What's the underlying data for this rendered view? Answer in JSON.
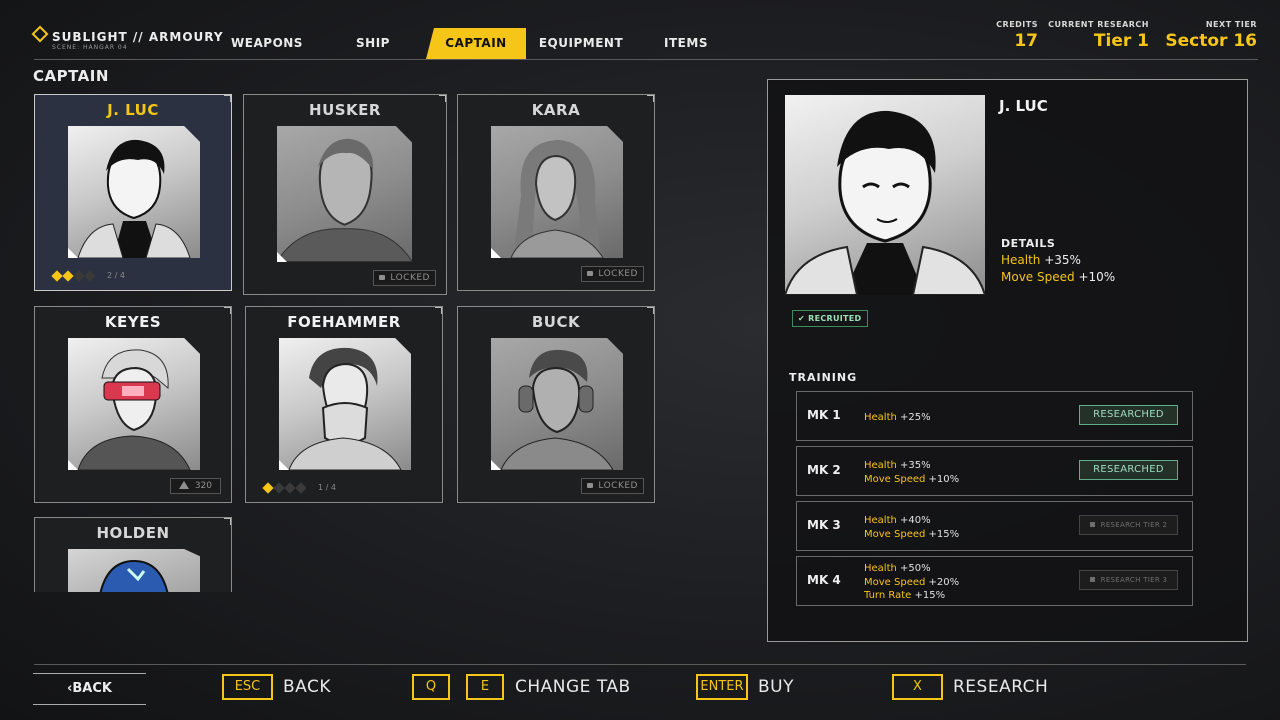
{
  "brand": {
    "title": "SUBLIGHT // ARMOURY",
    "subtitle": "SCENE: HANGAR 04"
  },
  "tabs": [
    {
      "label": "WEAPONS",
      "active": false
    },
    {
      "label": "SHIP",
      "active": false
    },
    {
      "label": "CAPTAIN",
      "active": true
    },
    {
      "label": "EQUIPMENT",
      "active": false
    },
    {
      "label": "ITEMS",
      "active": false
    }
  ],
  "stats": {
    "credits": {
      "label": "CREDITS",
      "value": "17"
    },
    "research": {
      "label": "CURRENT RESEARCH",
      "value": "Tier 1"
    },
    "next": {
      "label": "NEXT TIER",
      "value": "Sector 16"
    }
  },
  "section_title": "CAPTAIN",
  "captains": [
    {
      "name": "J. LUC",
      "status": "owned",
      "progress": "2 / 4",
      "level": 2,
      "max": 4
    },
    {
      "name": "HUSKER",
      "status": "locked",
      "lock_label": "LOCKED"
    },
    {
      "name": "KARA",
      "status": "locked",
      "lock_label": "LOCKED"
    },
    {
      "name": "KEYES",
      "status": "cost",
      "cost": "320"
    },
    {
      "name": "FOEHAMMER",
      "status": "owned",
      "progress": "1 / 4",
      "level": 1,
      "max": 4
    },
    {
      "name": "BUCK",
      "status": "locked",
      "lock_label": "LOCKED"
    },
    {
      "name": "HOLDEN",
      "status": "partial"
    }
  ],
  "detail": {
    "name": "J. LUC",
    "details_label": "DETAILS",
    "lines": [
      {
        "key": "Health",
        "value": "+35%"
      },
      {
        "key": "Move Speed",
        "value": "+10%"
      }
    ],
    "recruited": "RECRUITED",
    "training_label": "TRAINING",
    "training": [
      {
        "mk": "MK 1",
        "stats": [
          {
            "k": "Health",
            "v": "+25%"
          }
        ],
        "button": "RESEARCHED",
        "state": "done"
      },
      {
        "mk": "MK 2",
        "stats": [
          {
            "k": "Health",
            "v": "+35%"
          },
          {
            "k": "Move Speed",
            "v": "+10%"
          }
        ],
        "button": "RESEARCHED",
        "state": "done"
      },
      {
        "mk": "MK 3",
        "stats": [
          {
            "k": "Health",
            "v": "+40%"
          },
          {
            "k": "Move Speed",
            "v": "+15%"
          }
        ],
        "button": "RESEARCH TIER 2",
        "state": "locked"
      },
      {
        "mk": "MK 4",
        "stats": [
          {
            "k": "Health",
            "v": "+50%"
          },
          {
            "k": "Move Speed",
            "v": "+20%"
          },
          {
            "k": "Turn Rate",
            "v": "+15%"
          }
        ],
        "button": "RESEARCH TIER 3",
        "state": "locked"
      }
    ]
  },
  "footer": {
    "back": "‹BACK",
    "esc_key": "ESC",
    "esc_label": "BACK",
    "q_key": "Q",
    "e_key": "E",
    "tab_label": "CHANGE TAB",
    "enter_key": "ENTER",
    "enter_label": "BUY",
    "x_key": "X",
    "x_label": "RESEARCH"
  },
  "colors": {
    "accent": "#f5c518",
    "researched": "#5fae8a"
  }
}
